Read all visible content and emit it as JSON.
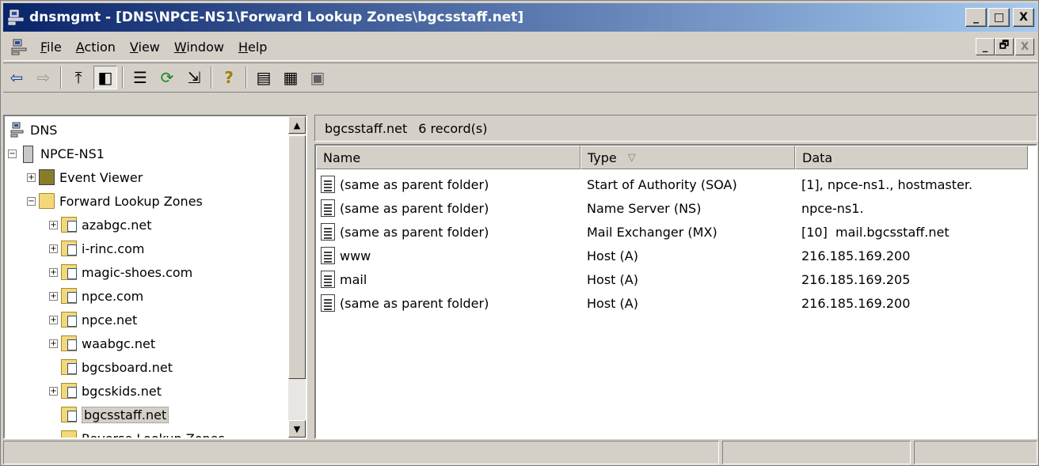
{
  "window": {
    "title": "dnsmgmt - [DNS\\NPCE-NS1\\Forward Lookup Zones\\bgcsstaff.net]",
    "title_buttons": [
      "_",
      "□",
      "X"
    ]
  },
  "menu": {
    "items": [
      {
        "label": "File",
        "mnemonic": "F"
      },
      {
        "label": "Action",
        "mnemonic": "A"
      },
      {
        "label": "View",
        "mnemonic": "V"
      },
      {
        "label": "Window",
        "mnemonic": "W"
      },
      {
        "label": "Help",
        "mnemonic": "H"
      }
    ],
    "mdi_buttons": [
      "_",
      "🗗",
      "X"
    ]
  },
  "toolbar": {
    "back_glyph": "⇦",
    "forward_glyph": "⇨",
    "up_glyph": "⤒",
    "show_tree_glyph": "◧",
    "properties_glyph": "☰",
    "refresh_glyph": "⟳",
    "export_glyph": "⇲",
    "help_glyph": "?",
    "new_record_glyph": "▤",
    "new_host_glyph": "▦",
    "new_alias_glyph": "▣"
  },
  "tree": {
    "root": "DNS",
    "server": "NPCE-NS1",
    "event_viewer": "Event Viewer",
    "forward_zones": "Forward Lookup Zones",
    "zones": [
      {
        "name": "azabgc.net",
        "expandable": true
      },
      {
        "name": "i-rinc.com",
        "expandable": true
      },
      {
        "name": "magic-shoes.com",
        "expandable": true
      },
      {
        "name": "npce.com",
        "expandable": true
      },
      {
        "name": "npce.net",
        "expandable": true
      },
      {
        "name": "waabgc.net",
        "expandable": true
      },
      {
        "name": "bgcsboard.net",
        "expandable": false
      },
      {
        "name": "bgcskids.net",
        "expandable": true
      },
      {
        "name": "bgcsstaff.net",
        "expandable": false,
        "selected": true
      }
    ],
    "reverse_zones": "Reverse Lookup Zones"
  },
  "details": {
    "header_zone": "bgcsstaff.net",
    "header_count": "6 record(s)",
    "columns": {
      "name": "Name",
      "type": "Type",
      "data": "Data",
      "sort_indicator": "▽"
    },
    "records": [
      {
        "name": "(same as parent folder)",
        "type": "Start of Authority (SOA)",
        "data": "[1], npce-ns1., hostmaster."
      },
      {
        "name": "(same as parent folder)",
        "type": "Name Server (NS)",
        "data": "npce-ns1."
      },
      {
        "name": "(same as parent folder)",
        "type": "Mail Exchanger (MX)",
        "data": "[10]  mail.bgcsstaff.net"
      },
      {
        "name": "www",
        "type": "Host (A)",
        "data": "216.185.169.200"
      },
      {
        "name": "mail",
        "type": "Host (A)",
        "data": "216.185.169.205"
      },
      {
        "name": "(same as parent folder)",
        "type": "Host (A)",
        "data": "216.185.169.200"
      }
    ]
  },
  "status": {
    "panes": [
      "",
      "",
      ""
    ]
  }
}
